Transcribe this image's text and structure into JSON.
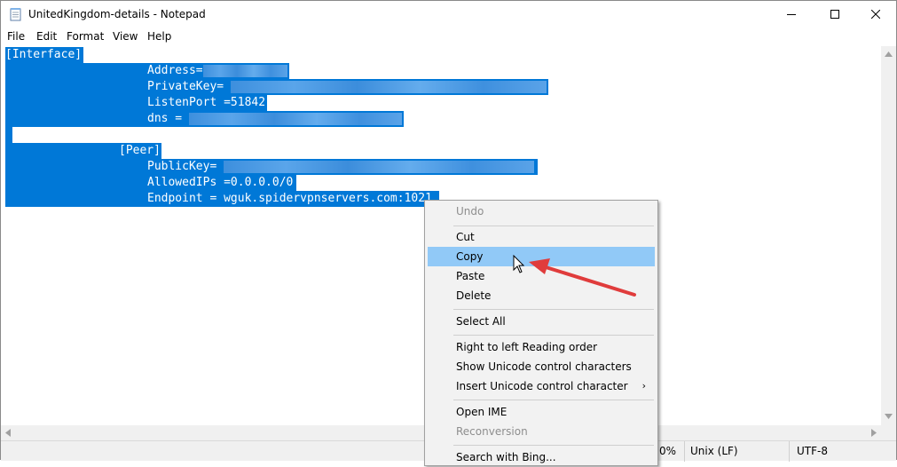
{
  "window": {
    "title": "UnitedKingdom-details - Notepad",
    "minimize_label": "Minimize",
    "maximize_label": "Maximize",
    "close_label": "Close"
  },
  "menu": {
    "file": "File",
    "edit": "Edit",
    "format": "Format",
    "view": "View",
    "help": "Help"
  },
  "document": {
    "interface_header": "[Interface]",
    "address_key": "Address=",
    "privatekey_key": "PrivateKey=",
    "listenport_line": "ListenPort =51842",
    "dns_key": "dns =",
    "peer_header": "[Peer]",
    "publickey_key": "PublicKey=",
    "allowedips_line": "AllowedIPs =0.0.0.0/0",
    "endpoint_line": "Endpoint = wguk.spidervpnservers.com:1021"
  },
  "context_menu": {
    "undo": "Undo",
    "cut": "Cut",
    "copy": "Copy",
    "paste": "Paste",
    "delete": "Delete",
    "select_all": "Select All",
    "rtl_reading": "Right to left Reading order",
    "show_unicode": "Show Unicode control characters",
    "insert_unicode": "Insert Unicode control character",
    "open_ime": "Open IME",
    "reconversion": "Reconversion",
    "search_bing": "Search with Bing..."
  },
  "status": {
    "zoom": "0%",
    "line_ending": "Unix (LF)",
    "encoding": "UTF-8"
  },
  "colors": {
    "selection": "#0078d7",
    "menu_hover": "#91c9f7",
    "annotation_arrow": "#e03c3c"
  }
}
